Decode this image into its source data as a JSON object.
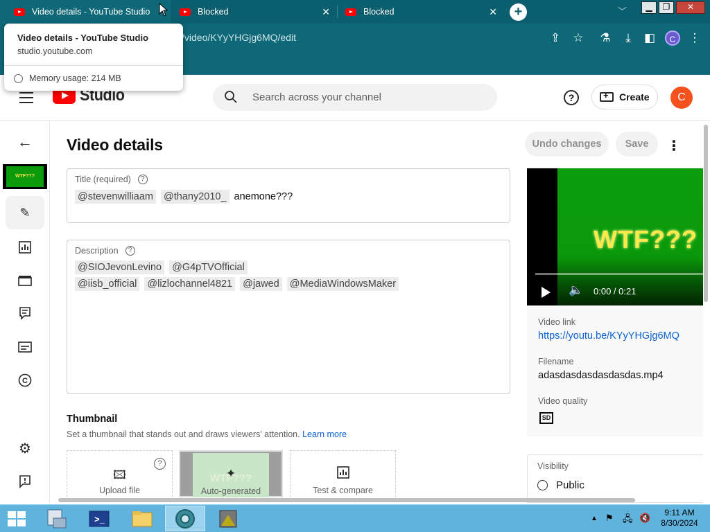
{
  "browser": {
    "tabs": [
      {
        "title": "Video details - YouTube Studio",
        "active": true
      },
      {
        "title": "Blocked",
        "active": false
      },
      {
        "title": "Blocked",
        "active": false
      }
    ],
    "url": "/video/KYyYHGjg6MQ/edit",
    "profile_initial": "C",
    "tooltip": {
      "title": "Video details - YouTube Studio",
      "domain": "studio.youtube.com",
      "memory": "Memory usage: 214 MB"
    }
  },
  "header": {
    "logo_text": "Studio",
    "search_placeholder": "Search across your channel",
    "help_label": "?",
    "create_label": "Create",
    "avatar_initial": "C"
  },
  "thumb_mini_text": "WTF???",
  "page": {
    "title": "Video details",
    "undo_label": "Undo changes",
    "save_label": "Save",
    "title_field": {
      "label": "Title (required)",
      "chips": [
        "@stevenwilliaam",
        "@thany2010_"
      ],
      "text": "anemone???"
    },
    "description_field": {
      "label": "Description",
      "line1": [
        "@SIOJevonLevino",
        "@G4pTVOfficial"
      ],
      "line2": [
        "@iisb_official",
        "@lizlochannel4821",
        "@jawed",
        "@MediaWindowsMaker"
      ]
    },
    "thumbnail": {
      "title": "Thumbnail",
      "subtitle": "Set a thumbnail that stands out and draws viewers' attention.",
      "learn_more": "Learn more",
      "upload_label": "Upload file",
      "autogen_label": "Auto-generated",
      "autogen_overlay": "WTF???",
      "test_label": "Test & compare"
    }
  },
  "player": {
    "overlay_text": "WTF???",
    "time": "0:00 / 0:21"
  },
  "info": {
    "video_link_label": "Video link",
    "video_link": "https://youtu.be/KYyYHGjg6MQ",
    "filename_label": "Filename",
    "filename": "adasdasdasdasdasdas.mp4",
    "quality_label": "Video quality",
    "quality_badge": "SD"
  },
  "visibility": {
    "label": "Visibility",
    "value": "Public"
  },
  "taskbar": {
    "time": "9:11 AM",
    "date": "8/30/2024"
  }
}
